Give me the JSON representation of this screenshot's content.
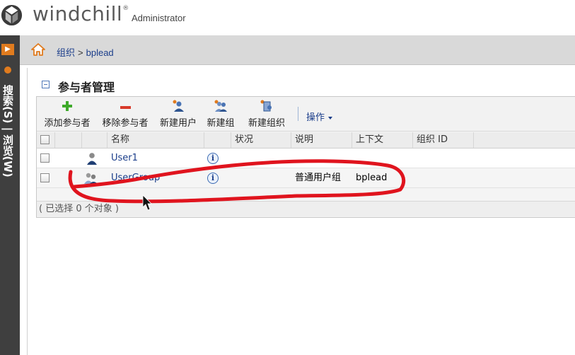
{
  "header": {
    "brand": "windchill",
    "trademark": "®",
    "user": "Administrator",
    "logo_icon": "windchill-logo-icon"
  },
  "left_nav": {
    "toggle_glyph": "▶",
    "vertical_label": "搜索(S) | 浏览(W)"
  },
  "breadcrumb": {
    "home_icon": "home-icon",
    "items": [
      "组织",
      "bplead"
    ],
    "separator": ">"
  },
  "panel": {
    "title": "参与者管理"
  },
  "toolbar": {
    "add_participant": "添加参与者",
    "remove_participant": "移除参与者",
    "new_user": "新建用户",
    "new_group": "新建组",
    "new_org": "新建组织",
    "actions": "操作"
  },
  "table": {
    "columns": [
      "名称",
      "状况",
      "说明",
      "上下文",
      "组织 ID"
    ],
    "rows": [
      {
        "name": "User1",
        "status": "",
        "description": "",
        "context": "",
        "org_id": "",
        "type": "user"
      },
      {
        "name": "UserGroup",
        "status": "",
        "description": "普通用户组",
        "context": "bplead",
        "org_id": "",
        "type": "group"
      }
    ],
    "selection_status": "( 已选择 0 个对象 )"
  },
  "colors": {
    "link": "#1a3d8a",
    "nav_dark": "#3f3f3f",
    "accent_orange": "#e07b1e",
    "annotation_red": "#e0141e"
  }
}
